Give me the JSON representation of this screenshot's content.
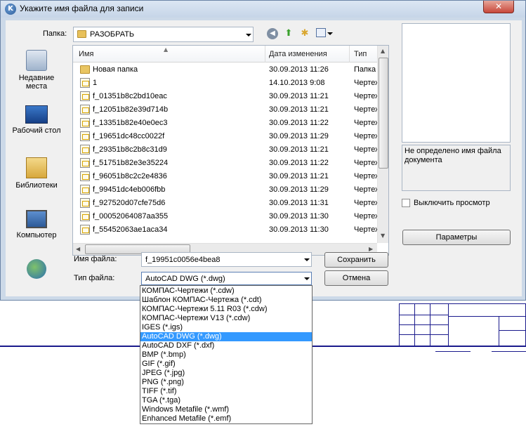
{
  "dialog": {
    "title": "Укажите имя файла для записи",
    "close_label": "✕"
  },
  "folder": {
    "label": "Папка:",
    "current": "РАЗОБРАТЬ"
  },
  "places": [
    {
      "label1": "Недавние",
      "label2": "места",
      "icon": "recent-places-icon"
    },
    {
      "label1": "Рабочий стол",
      "label2": "",
      "icon": "desktop-icon"
    },
    {
      "label1": "Библиотеки",
      "label2": "",
      "icon": "libraries-icon"
    },
    {
      "label1": "Компьютер",
      "label2": "",
      "icon": "computer-icon"
    },
    {
      "label1": "",
      "label2": "",
      "icon": "network-icon"
    }
  ],
  "list": {
    "columns": [
      "Имя",
      "Дата изменения",
      "Тип"
    ],
    "rows": [
      {
        "name": "Новая папка",
        "date": "30.09.2013 11:26",
        "type": "Папка",
        "kind": "folder"
      },
      {
        "name": "1",
        "date": "14.10.2013 9:08",
        "type": "Чертеж",
        "kind": "dwg"
      },
      {
        "name": "f_01351b8c2bd10eac",
        "date": "30.09.2013 11:21",
        "type": "Чертеж",
        "kind": "dwg"
      },
      {
        "name": "f_12051b82e39d714b",
        "date": "30.09.2013 11:21",
        "type": "Чертеж",
        "kind": "dwg"
      },
      {
        "name": "f_13351b82e40e0ec3",
        "date": "30.09.2013 11:22",
        "type": "Чертеж",
        "kind": "dwg"
      },
      {
        "name": "f_19651dc48cc0022f",
        "date": "30.09.2013 11:29",
        "type": "Чертеж",
        "kind": "dwg"
      },
      {
        "name": "f_29351b8c2b8c31d9",
        "date": "30.09.2013 11:21",
        "type": "Чертеж",
        "kind": "dwg"
      },
      {
        "name": "f_51751b82e3e35224",
        "date": "30.09.2013 11:22",
        "type": "Чертеж",
        "kind": "dwg"
      },
      {
        "name": "f_96051b8c2c2e4836",
        "date": "30.09.2013 11:21",
        "type": "Чертеж",
        "kind": "dwg"
      },
      {
        "name": "f_99451dc4eb006fbb",
        "date": "30.09.2013 11:29",
        "type": "Чертеж",
        "kind": "dwg"
      },
      {
        "name": "f_927520d07cfe75d6",
        "date": "30.09.2013 11:31",
        "type": "Чертеж",
        "kind": "dwg"
      },
      {
        "name": "f_00052064087aa355",
        "date": "30.09.2013 11:30",
        "type": "Чертеж",
        "kind": "dwg"
      },
      {
        "name": "f_55452063ae1aca34",
        "date": "30.09.2013 11:30",
        "type": "Чертеж",
        "kind": "dwg"
      }
    ]
  },
  "fields": {
    "filename_label": "Имя файла:",
    "filename_value": "f_19951c0056e4bea8",
    "filetype_label": "Тип файла:",
    "filetype_value": "AutoCAD DWG (*.dwg)"
  },
  "buttons": {
    "save": "Сохранить",
    "cancel": "Отмена",
    "params": "Параметры"
  },
  "preview": {
    "info": "Не определено имя файла документа",
    "disable_label": "Выключить просмотр"
  },
  "filetypes": {
    "selected_index": 5,
    "items": [
      "КОМПАС-Чертежи (*.cdw)",
      "Шаблон КОМПАС-Чертежа (*.cdt)",
      "КОМПАС-Чертежи 5.11 R03 (*.cdw)",
      "КОМПАС-Чертежи V13 (*.cdw)",
      "IGES (*.igs)",
      "AutoCAD DWG (*.dwg)",
      "AutoCAD DXF (*.dxf)",
      "BMP (*.bmp)",
      "GIF (*.gif)",
      "JPEG (*.jpg)",
      "PNG (*.png)",
      "TIFF (*.tif)",
      "TGA (*.tga)",
      "Windows Metafile (*.wmf)",
      "Enhanced Metafile (*.emf)"
    ]
  },
  "colors": {
    "selection": "#3399ff",
    "drawing_lines": "#1a1a8c"
  }
}
